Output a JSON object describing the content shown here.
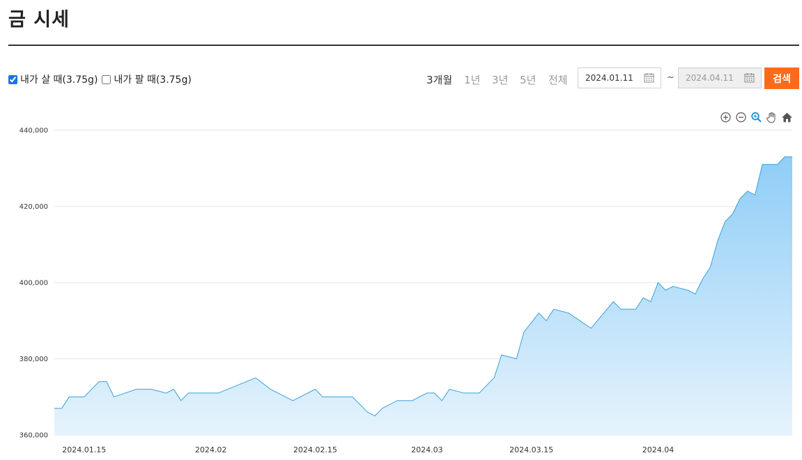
{
  "page": {
    "title": "금 시세"
  },
  "options": {
    "buy": {
      "label": "내가 살 때(3.75g)",
      "checked": true
    },
    "sell": {
      "label": "내가 팔 때(3.75g)",
      "checked": false
    }
  },
  "periods": [
    {
      "label": "3개월",
      "active": true
    },
    {
      "label": "1년",
      "active": false
    },
    {
      "label": "3년",
      "active": false
    },
    {
      "label": "5년",
      "active": false
    },
    {
      "label": "전체",
      "active": false
    }
  ],
  "date_range": {
    "start": "2024.01.11",
    "end": "2024.04.11",
    "separator": "~",
    "search_label": "검색"
  },
  "toolbar_icons": [
    "zoom-in-icon",
    "zoom-out-icon",
    "magnifier-icon",
    "pan-hand-icon",
    "home-icon"
  ],
  "colors": {
    "line": "#3aa0dd",
    "fill_top": "#8fcdf7",
    "fill_bottom": "#e6f3fc",
    "accent": "#ff6a1a",
    "grid": "#e6e6e6"
  },
  "chart_data": {
    "type": "area",
    "ylim": [
      360000,
      440000
    ],
    "yticks": [
      {
        "value": 440000,
        "label": "440,000"
      },
      {
        "value": 420000,
        "label": "420,000"
      },
      {
        "value": 400000,
        "label": "400,000"
      },
      {
        "value": 380000,
        "label": "380,000"
      },
      {
        "value": 360000,
        "label": "360,000"
      }
    ],
    "xlim": [
      "2024-01-11",
      "2024-04-11"
    ],
    "xticks": [
      {
        "date": "2024-01-15",
        "label": "2024.01.15"
      },
      {
        "date": "2024-02-01",
        "label": "2024.02"
      },
      {
        "date": "2024-02-15",
        "label": "2024.02.15"
      },
      {
        "date": "2024-03-01",
        "label": "2024.03"
      },
      {
        "date": "2024-03-15",
        "label": "2024.03.15"
      },
      {
        "date": "2024-04-01",
        "label": "2024.04"
      }
    ],
    "grid": true,
    "series": [
      {
        "points": [
          [
            "2024-01-11",
            367000
          ],
          [
            "2024-01-12",
            367000
          ],
          [
            "2024-01-13",
            370000
          ],
          [
            "2024-01-15",
            370000
          ],
          [
            "2024-01-16",
            372000
          ],
          [
            "2024-01-17",
            374000
          ],
          [
            "2024-01-18",
            374000
          ],
          [
            "2024-01-19",
            370000
          ],
          [
            "2024-01-22",
            372000
          ],
          [
            "2024-01-24",
            372000
          ],
          [
            "2024-01-26",
            371000
          ],
          [
            "2024-01-27",
            372000
          ],
          [
            "2024-01-28",
            369000
          ],
          [
            "2024-01-29",
            371000
          ],
          [
            "2024-01-31",
            371000
          ],
          [
            "2024-02-02",
            371000
          ],
          [
            "2024-02-07",
            375000
          ],
          [
            "2024-02-09",
            372000
          ],
          [
            "2024-02-12",
            369000
          ],
          [
            "2024-02-15",
            372000
          ],
          [
            "2024-02-16",
            370000
          ],
          [
            "2024-02-20",
            370000
          ],
          [
            "2024-02-22",
            366000
          ],
          [
            "2024-02-23",
            365000
          ],
          [
            "2024-02-24",
            367000
          ],
          [
            "2024-02-26",
            369000
          ],
          [
            "2024-02-28",
            369000
          ],
          [
            "2024-03-01",
            371000
          ],
          [
            "2024-03-02",
            371000
          ],
          [
            "2024-03-03",
            369000
          ],
          [
            "2024-03-04",
            372000
          ],
          [
            "2024-03-06",
            371000
          ],
          [
            "2024-03-08",
            371000
          ],
          [
            "2024-03-10",
            375000
          ],
          [
            "2024-03-11",
            381000
          ],
          [
            "2024-03-13",
            380000
          ],
          [
            "2024-03-14",
            387000
          ],
          [
            "2024-03-16",
            392000
          ],
          [
            "2024-03-17",
            390000
          ],
          [
            "2024-03-18",
            393000
          ],
          [
            "2024-03-20",
            392000
          ],
          [
            "2024-03-23",
            388000
          ],
          [
            "2024-03-26",
            395000
          ],
          [
            "2024-03-27",
            393000
          ],
          [
            "2024-03-29",
            393000
          ],
          [
            "2024-03-30",
            396000
          ],
          [
            "2024-03-31",
            395000
          ],
          [
            "2024-04-01",
            400000
          ],
          [
            "2024-04-02",
            398000
          ],
          [
            "2024-04-03",
            399000
          ],
          [
            "2024-04-05",
            398000
          ],
          [
            "2024-04-06",
            397000
          ],
          [
            "2024-04-07",
            401000
          ],
          [
            "2024-04-08",
            404000
          ],
          [
            "2024-04-09",
            411000
          ],
          [
            "2024-04-10",
            416000
          ],
          [
            "2024-04-11",
            418000
          ],
          [
            "2024-04-12",
            422000
          ],
          [
            "2024-04-13",
            424000
          ],
          [
            "2024-04-14",
            423000
          ],
          [
            "2024-04-15",
            431000
          ],
          [
            "2024-04-16",
            431000
          ],
          [
            "2024-04-17",
            431000
          ],
          [
            "2024-04-18",
            433000
          ],
          [
            "2024-04-19",
            433000
          ]
        ]
      }
    ]
  }
}
